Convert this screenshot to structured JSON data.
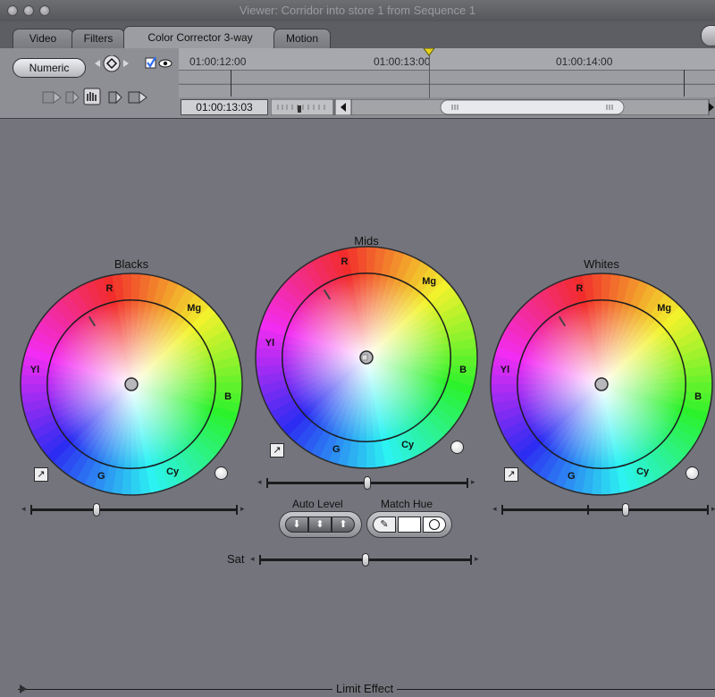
{
  "window": {
    "title": "Viewer: Corridor into store 1 from Sequence 1"
  },
  "tabs": [
    {
      "label": "Video"
    },
    {
      "label": "Filters"
    },
    {
      "label": "Color Corrector 3-way"
    },
    {
      "label": "Motion"
    }
  ],
  "controls": {
    "numeric_label": "Numeric",
    "checkbox_checked": true
  },
  "timeline": {
    "ruler_labels": [
      "01:00:12:00",
      "01:00:13:00",
      "01:00:14:00"
    ],
    "current_timecode": "01:00:13:03"
  },
  "wheels": [
    {
      "label": "Blacks",
      "hue_labels": {
        "r": "R",
        "mg": "Mg",
        "yl": "Yl",
        "b": "B",
        "g": "G",
        "cy": "Cy"
      },
      "balance": [
        0,
        0
      ],
      "level": 0.32
    },
    {
      "label": "Mids",
      "hue_labels": {
        "r": "R",
        "mg": "Mg",
        "yl": "Yl",
        "b": "B",
        "g": "G",
        "cy": "Cy"
      },
      "balance": [
        0,
        0
      ],
      "level": 0.5
    },
    {
      "label": "Whites",
      "hue_labels": {
        "r": "R",
        "mg": "Mg",
        "yl": "Yl",
        "b": "B",
        "g": "G",
        "cy": "Cy"
      },
      "balance": [
        0,
        0
      ],
      "level": 0.6
    }
  ],
  "auto_level": {
    "label": "Auto Level"
  },
  "match_hue": {
    "label": "Match Hue"
  },
  "sat": {
    "label": "Sat",
    "value": 0.5
  },
  "limit_effect": {
    "label": "Limit Effect"
  },
  "colors": {
    "background": "#74757c",
    "accent": "#2f6ef3"
  }
}
